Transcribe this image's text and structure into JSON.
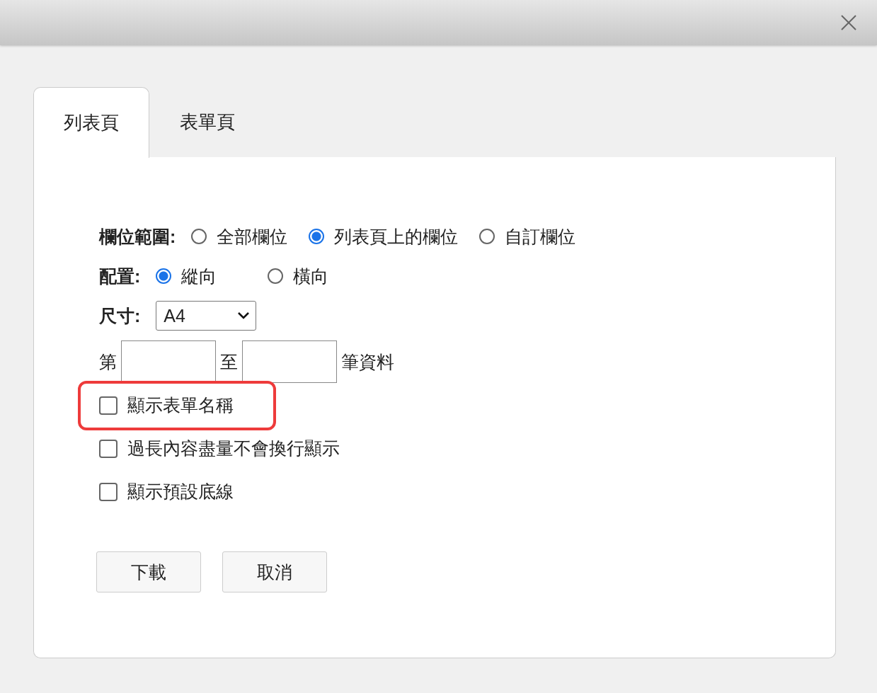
{
  "tabs": [
    {
      "label": "列表頁",
      "selected": true
    },
    {
      "label": "表單頁",
      "selected": false
    }
  ],
  "field_range": {
    "label": "欄位範圍:",
    "options": [
      {
        "label": "全部欄位",
        "selected": false
      },
      {
        "label": "列表頁上的欄位",
        "selected": true
      },
      {
        "label": "自訂欄位",
        "selected": false
      }
    ]
  },
  "layout": {
    "label": "配置:",
    "options": [
      {
        "label": "縱向",
        "selected": true
      },
      {
        "label": "橫向",
        "selected": false
      }
    ]
  },
  "size": {
    "label": "尺寸:",
    "value": "A4"
  },
  "record_range": {
    "prefix": "第",
    "middle": "至",
    "suffix": "筆資料"
  },
  "checkboxes": [
    {
      "label": "顯示表單名稱",
      "checked": false,
      "highlighted": true
    },
    {
      "label": "過長內容盡量不會換行顯示",
      "checked": false,
      "highlighted": false
    },
    {
      "label": "顯示預設底線",
      "checked": false,
      "highlighted": false
    }
  ],
  "buttons": [
    "下載",
    "取消"
  ]
}
